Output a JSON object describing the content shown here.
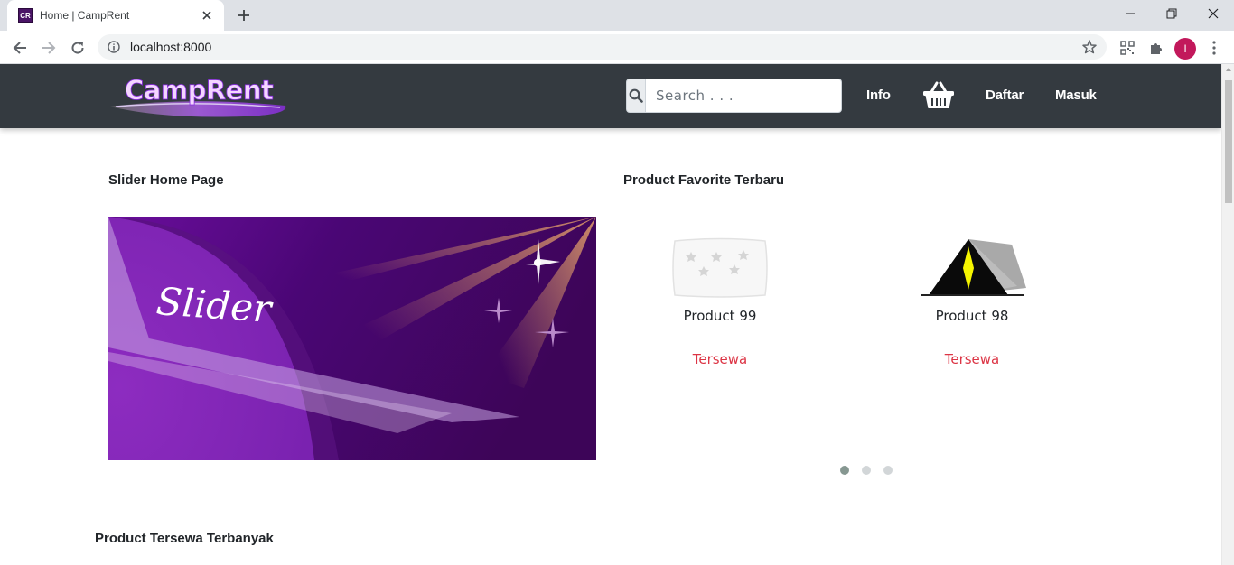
{
  "browser": {
    "tab_title": "Home | CampRent",
    "favicon_text": "CR",
    "url": "localhost:8000",
    "profile_initial": "I",
    "profile_color": "#c2185b"
  },
  "site": {
    "brand": "CampRent",
    "search_placeholder": "Search . . .",
    "nav": {
      "info": "Info",
      "register": "Daftar",
      "login": "Masuk"
    },
    "navbar_color": "#343a40"
  },
  "slider_section": {
    "title": "Slider Home Page",
    "slide_caption": "Slider"
  },
  "favorites": {
    "title": "Product Favorite Terbaru",
    "products": [
      {
        "name": "Product 99",
        "status": "Tersewa",
        "icon": "sleeping-bag-icon"
      },
      {
        "name": "Product 98",
        "status": "Tersewa",
        "icon": "tent-icon"
      }
    ],
    "carousel_pages": 3,
    "active_page": 1,
    "status_color": "#dc3545"
  },
  "most_rented": {
    "title": "Product Tersewa Terbanyak"
  }
}
